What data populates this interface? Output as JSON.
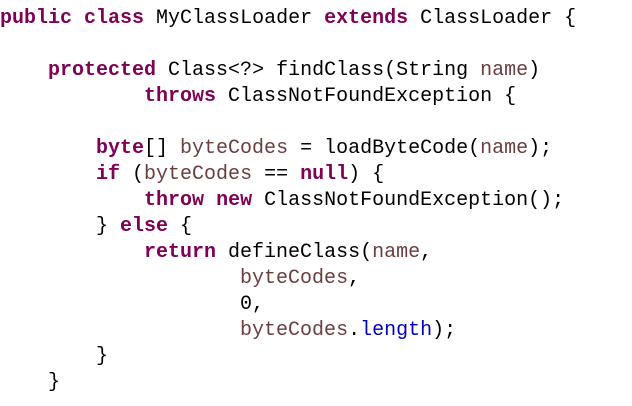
{
  "code": {
    "lines": [
      [
        {
          "t": "public",
          "s": "kw"
        },
        {
          "t": " "
        },
        {
          "t": "class",
          "s": "kw"
        },
        {
          "t": " MyClassLoader "
        },
        {
          "t": "extends",
          "s": "kw"
        },
        {
          "t": " ClassLoader {"
        }
      ],
      [],
      [
        {
          "t": "    "
        },
        {
          "t": "protected",
          "s": "kw"
        },
        {
          "t": " Class<?> findClass(String "
        },
        {
          "t": "name",
          "s": "var"
        },
        {
          "t": ")"
        }
      ],
      [
        {
          "t": "            "
        },
        {
          "t": "throws",
          "s": "kw"
        },
        {
          "t": " ClassNotFoundException {"
        }
      ],
      [],
      [
        {
          "t": "        "
        },
        {
          "t": "byte",
          "s": "kw"
        },
        {
          "t": "[] "
        },
        {
          "t": "byteCodes",
          "s": "var"
        },
        {
          "t": " = loadByteCode("
        },
        {
          "t": "name",
          "s": "var"
        },
        {
          "t": ");"
        }
      ],
      [
        {
          "t": "        "
        },
        {
          "t": "if",
          "s": "kw"
        },
        {
          "t": " ("
        },
        {
          "t": "byteCodes",
          "s": "var"
        },
        {
          "t": " == "
        },
        {
          "t": "null",
          "s": "kw"
        },
        {
          "t": ") {"
        }
      ],
      [
        {
          "t": "            "
        },
        {
          "t": "throw",
          "s": "kw"
        },
        {
          "t": " "
        },
        {
          "t": "new",
          "s": "kw"
        },
        {
          "t": " ClassNotFoundException();"
        }
      ],
      [
        {
          "t": "        } "
        },
        {
          "t": "else",
          "s": "kw"
        },
        {
          "t": " {"
        }
      ],
      [
        {
          "t": "            "
        },
        {
          "t": "return",
          "s": "kw"
        },
        {
          "t": " defineClass("
        },
        {
          "t": "name",
          "s": "var"
        },
        {
          "t": ","
        }
      ],
      [
        {
          "t": "                    "
        },
        {
          "t": "byteCodes",
          "s": "var"
        },
        {
          "t": ","
        }
      ],
      [
        {
          "t": "                    0,"
        }
      ],
      [
        {
          "t": "                    "
        },
        {
          "t": "byteCodes",
          "s": "var"
        },
        {
          "t": "."
        },
        {
          "t": "length",
          "s": "fld"
        },
        {
          "t": ");"
        }
      ],
      [
        {
          "t": "        }"
        }
      ],
      [
        {
          "t": "    }"
        }
      ]
    ]
  }
}
